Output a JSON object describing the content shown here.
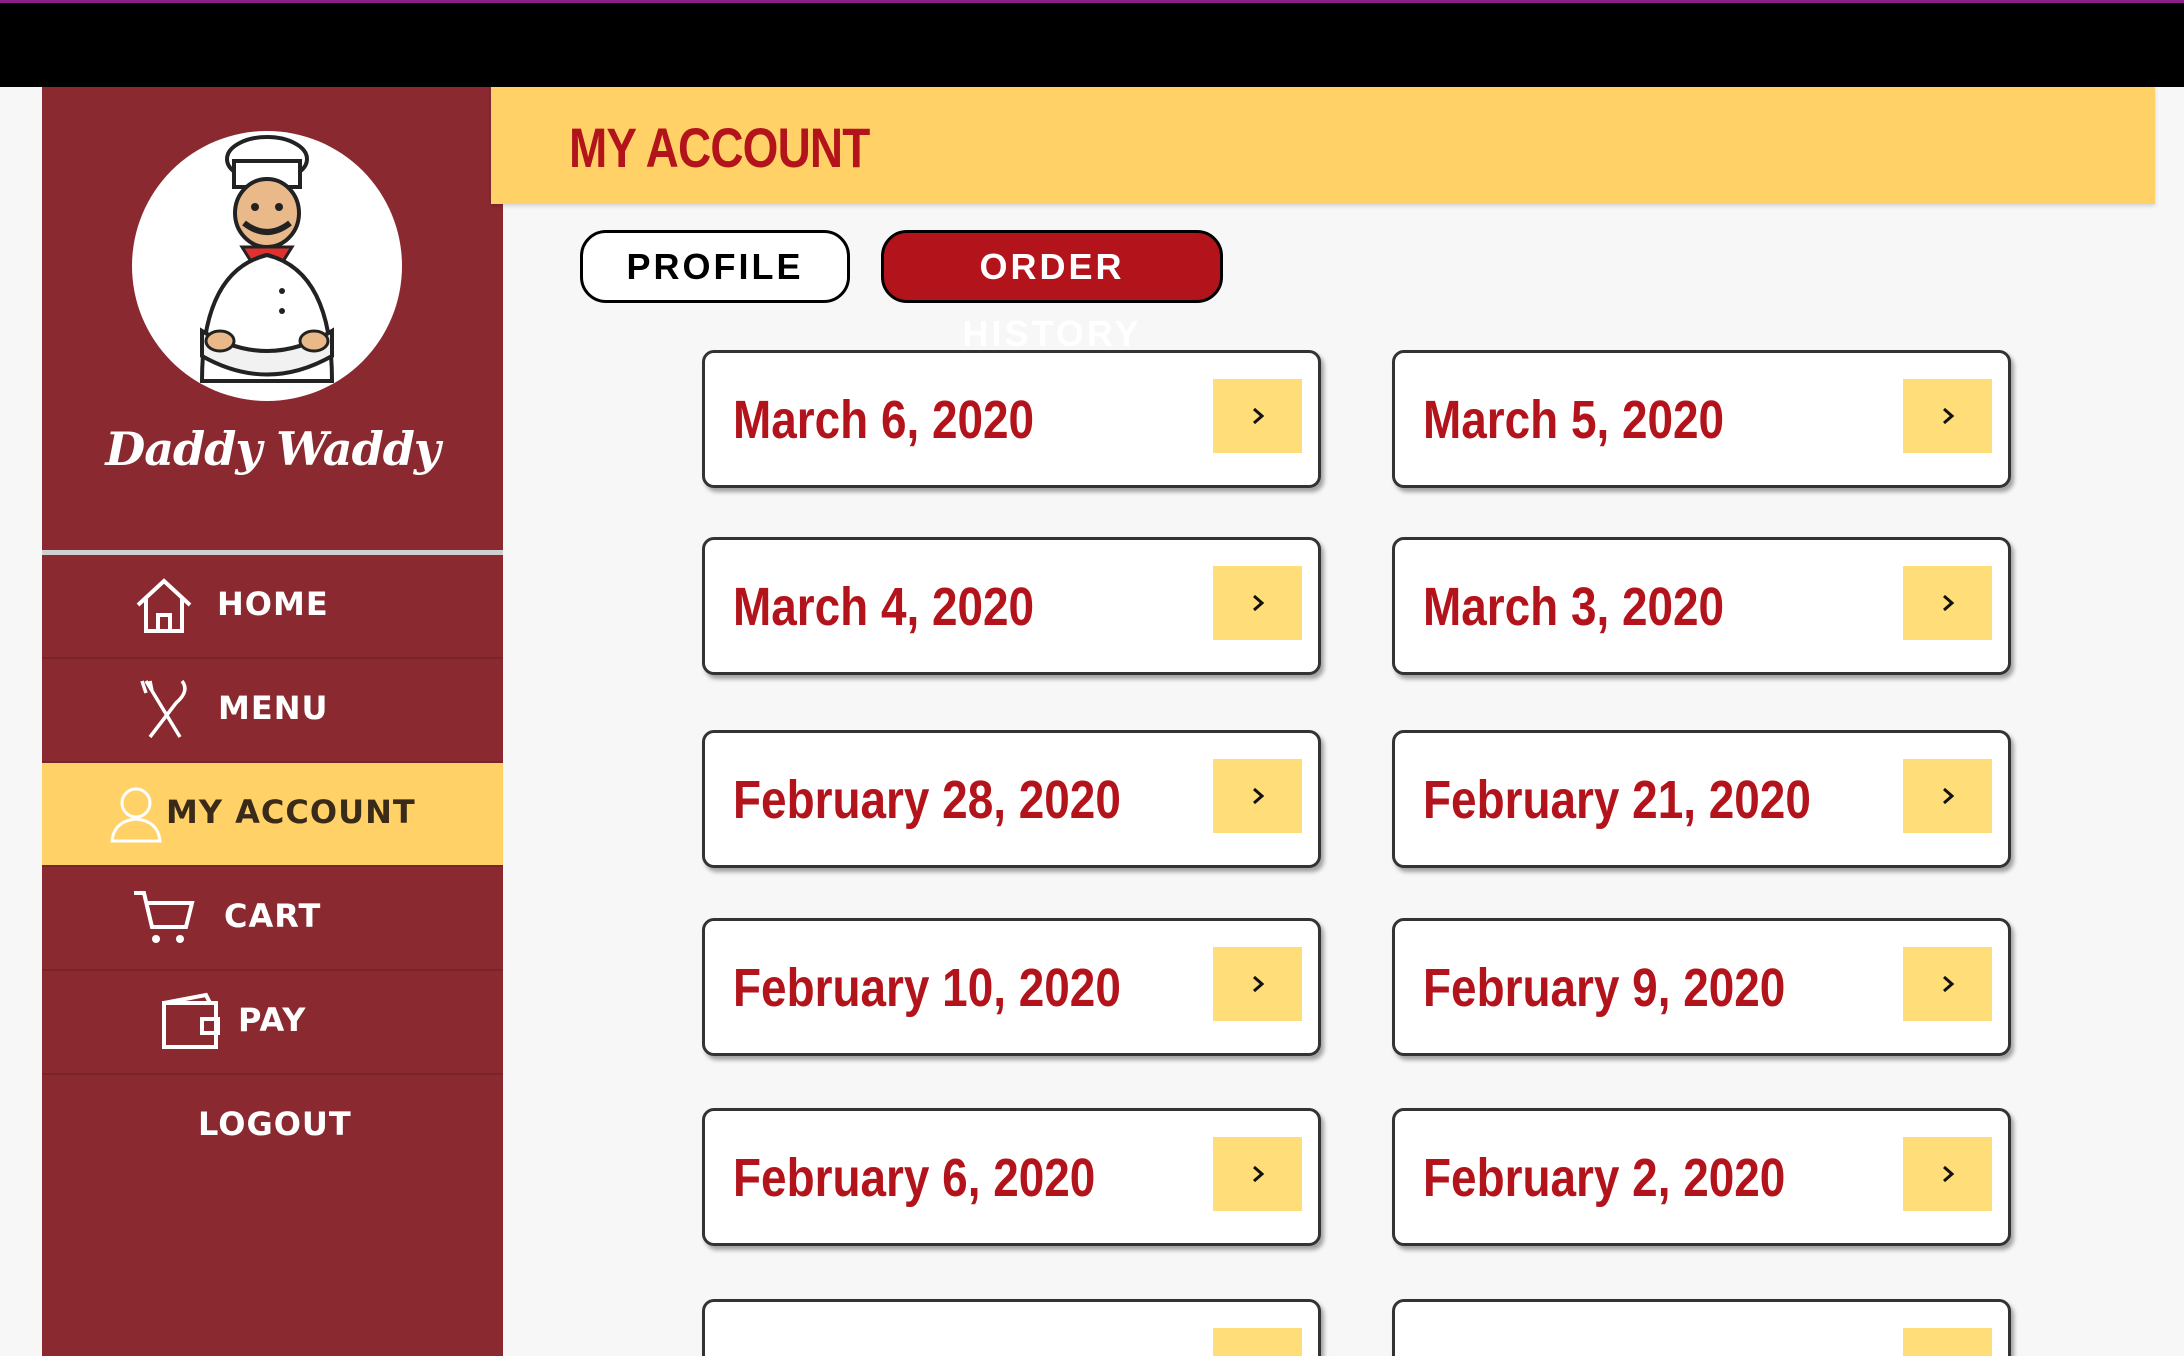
{
  "brand": {
    "name": "Daddy Waddy"
  },
  "nav": {
    "items": [
      {
        "label": "HOME",
        "icon": "home-icon"
      },
      {
        "label": "MENU",
        "icon": "utensils-icon"
      },
      {
        "label": "MY ACCOUNT",
        "icon": "user-icon",
        "active": true
      },
      {
        "label": "CART",
        "icon": "cart-icon"
      },
      {
        "label": "PAY",
        "icon": "wallet-icon"
      },
      {
        "label": "LOGOUT"
      }
    ]
  },
  "header": {
    "title": "MY ACCOUNT"
  },
  "tabs": [
    {
      "label": "PROFILE"
    },
    {
      "label": "ORDER HISTORY",
      "active": true
    }
  ],
  "orders": [
    {
      "date": "March 6, 2020"
    },
    {
      "date": "March 5, 2020"
    },
    {
      "date": "March 4, 2020"
    },
    {
      "date": "March 3, 2020"
    },
    {
      "date": "February 28, 2020"
    },
    {
      "date": "February 21, 2020"
    },
    {
      "date": "February 10, 2020"
    },
    {
      "date": "February 9, 2020"
    },
    {
      "date": "February 6, 2020"
    },
    {
      "date": "February 2, 2020"
    }
  ],
  "colors": {
    "sidebar": "#8a2a30",
    "accent_yellow": "#ffd166",
    "accent_red": "#b3141c"
  }
}
